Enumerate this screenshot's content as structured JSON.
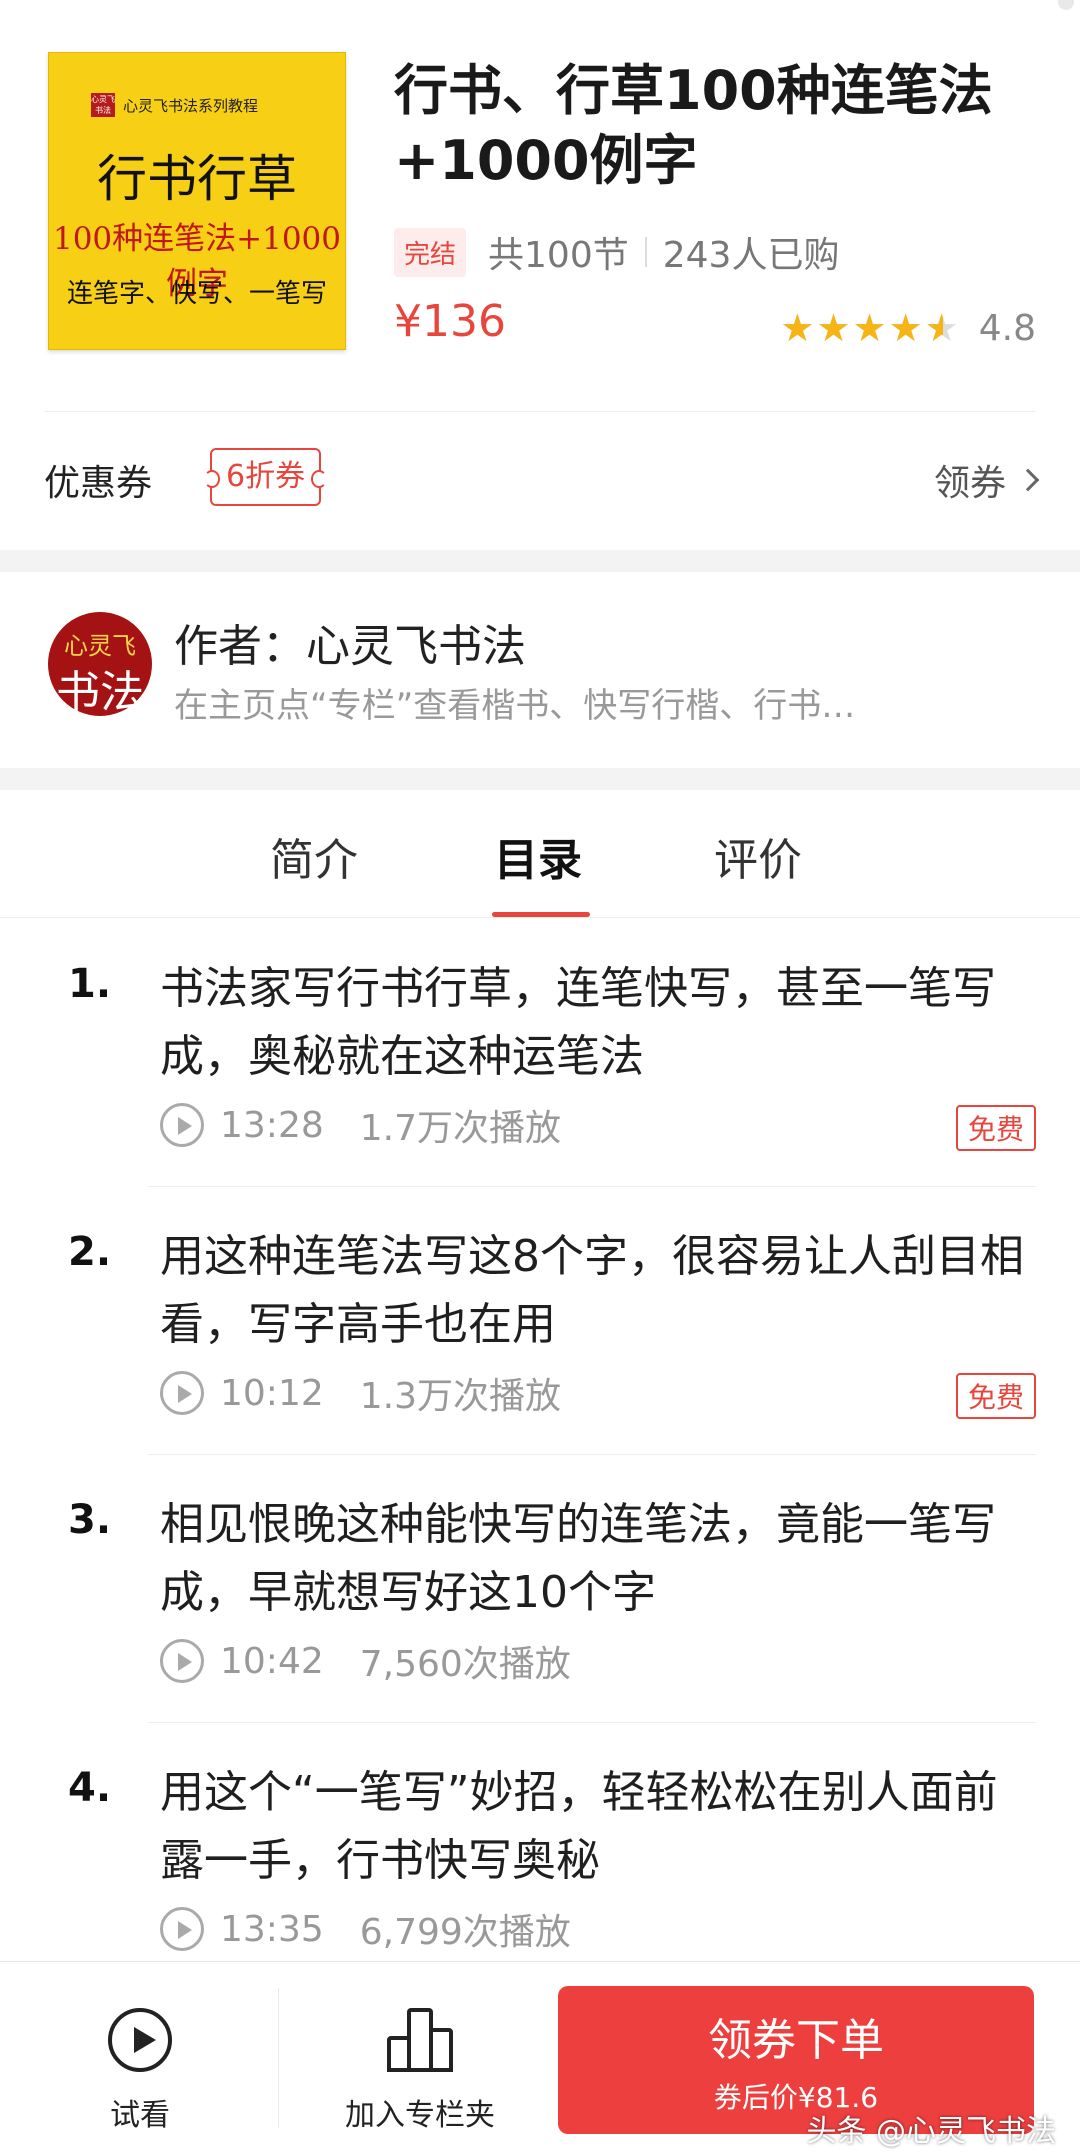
{
  "product": {
    "cover": {
      "brand_seal": "心灵飞书法",
      "brand_text": "心灵飞书法系列教程",
      "title": "行书行草",
      "subtitle": "100种连笔法+1000例字",
      "tagline": "连笔字、快写、一笔写"
    },
    "title": "行书、行草100种连笔法+1000例字",
    "status": "完结",
    "lessons_count": "共100节",
    "buyers": "243人已购",
    "price": "¥136",
    "rating": "4.8",
    "rating_fraction": 0.9,
    "colors": {
      "accent": "#e8463c",
      "star": "#f6b416",
      "cover_bg": "#f7cf15"
    }
  },
  "coupon": {
    "label": "优惠券",
    "tag": "6折券",
    "action": "领券"
  },
  "author": {
    "avatar_top": "心灵飞",
    "avatar_bottom": "书法",
    "name": "作者：心灵飞书法",
    "description": "在主页点“专栏”查看楷书、快写行楷、行书…"
  },
  "tabs": [
    "简介",
    "目录",
    "评价"
  ],
  "active_tab": "目录",
  "lessons": [
    {
      "num": "1.",
      "title": "书法家写行书行草，连笔快写，甚至一笔写成，奥秘就在这种运笔法",
      "duration": "13:28",
      "plays": "1.7万次播放",
      "badge": "免费"
    },
    {
      "num": "2.",
      "title": "用这种连笔法写这8个字，很容易让人刮目相看，写字高手也在用",
      "duration": "10:12",
      "plays": "1.3万次播放",
      "badge": "免费"
    },
    {
      "num": "3.",
      "title": "相见恨晚这种能快写的连笔法，竟能一笔写成，早就想写好这10个字",
      "duration": "10:42",
      "plays": "7,560次播放",
      "badge": ""
    },
    {
      "num": "4.",
      "title": "用这个“一笔写”妙招，轻轻松松在别人面前露一手，行书快写奥秘",
      "duration": "13:35",
      "plays": "6,799次播放",
      "badge": ""
    }
  ],
  "bottom_bar": {
    "trial_label": "试看",
    "folder_label": "加入专栏夹",
    "buy_label": "领券下单",
    "buy_sub": "券后价¥81.6"
  },
  "watermark": "头条 @心灵飞书法"
}
